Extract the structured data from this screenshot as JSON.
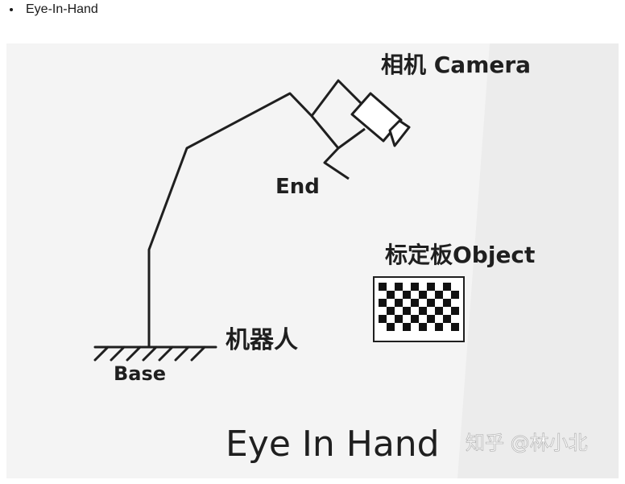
{
  "heading": {
    "bullet_text": "Eye-In-Hand"
  },
  "diagram": {
    "label_camera": "相机 Camera",
    "label_end": "End",
    "label_object": "标定板Object",
    "label_robot": "机器人",
    "label_base": "Base",
    "title": "Eye In Hand",
    "watermark": "知乎 @林小北"
  }
}
